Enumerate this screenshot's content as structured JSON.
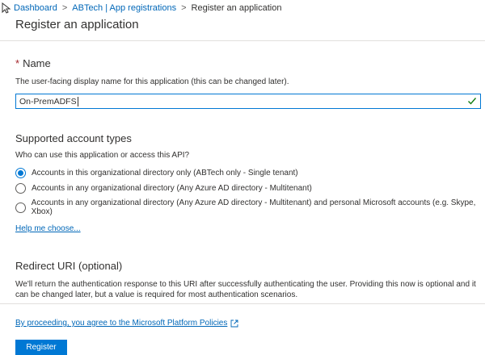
{
  "breadcrumb": {
    "items": [
      "Dashboard",
      "ABTech | App registrations"
    ],
    "separator": ">",
    "current": "Register an application"
  },
  "page": {
    "title": "Register an application"
  },
  "name_section": {
    "required_marker": "*",
    "title": "Name",
    "description": "The user-facing display name for this application (this can be changed later).",
    "input_value": "On-PremADFS"
  },
  "account_types": {
    "title": "Supported account types",
    "question": "Who can use this application or access this API?",
    "options": [
      {
        "label": "Accounts in this organizational directory only (ABTech only - Single tenant)",
        "selected": true
      },
      {
        "label": "Accounts in any organizational directory (Any Azure AD directory - Multitenant)",
        "selected": false
      },
      {
        "label": "Accounts in any organizational directory (Any Azure AD directory - Multitenant) and personal Microsoft accounts (e.g. Skype, Xbox)",
        "selected": false
      }
    ],
    "help_link": "Help me choose..."
  },
  "redirect": {
    "title": "Redirect URI (optional)",
    "description": "We'll return the authentication response to this URI after successfully authenticating the user. Providing this now is optional and it can be changed later, but a value is required for most authentication scenarios."
  },
  "footer": {
    "policy_text": "By proceeding, you agree to the Microsoft Platform Policies",
    "register_label": "Register"
  },
  "colors": {
    "accent": "#0078d4",
    "link": "#0067b8",
    "required": "#a4262c",
    "valid_check": "#107c10"
  },
  "icons": {
    "cursor": "mouse-pointer-icon",
    "check": "checkmark-icon",
    "external": "external-link-icon"
  }
}
